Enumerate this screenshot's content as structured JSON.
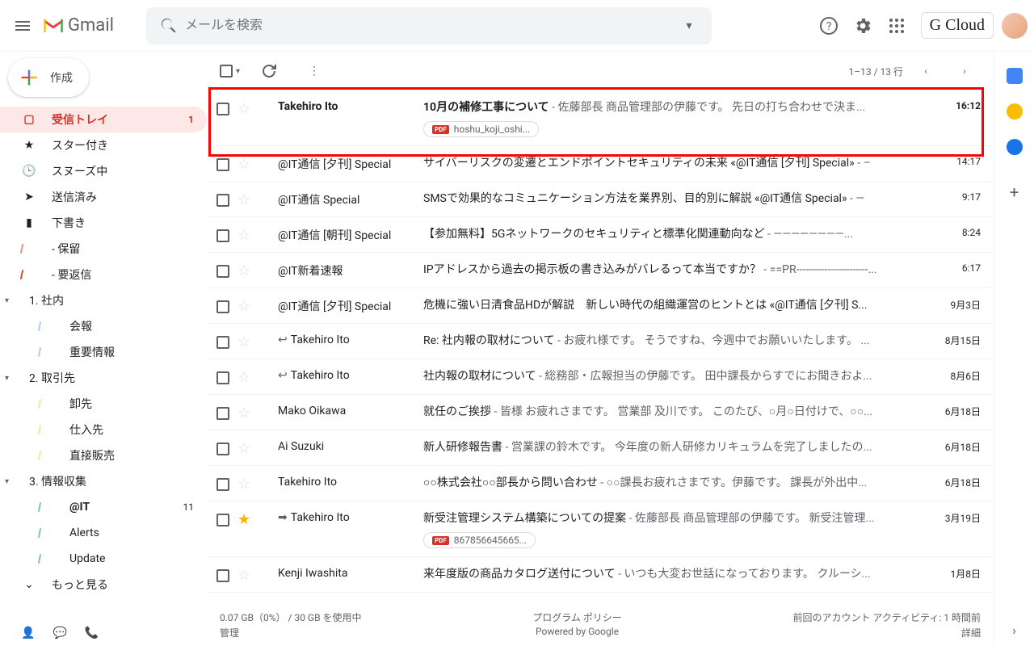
{
  "header": {
    "logo_text": "Gmail",
    "search_placeholder": "メールを検索",
    "gcloud_label": "G Cloud"
  },
  "compose_label": "作成",
  "nav": {
    "inbox": {
      "label": "受信トレイ",
      "count": "1"
    },
    "starred": "スター付き",
    "snoozed": "スヌーズ中",
    "sent": "送信済み",
    "drafts": "下書き",
    "hold": "- 保留",
    "reply_needed": "- 要返信",
    "section1": "1. 社内",
    "s1_news": "会報",
    "s1_important": "重要情報",
    "section2": "2. 取引先",
    "s2_sales": "卸先",
    "s2_supplier": "仕入先",
    "s2_direct": "直接販売",
    "section3": "3. 情報収集",
    "s3_atit": "@IT",
    "s3_atit_count": "11",
    "s3_alerts": "Alerts",
    "s3_update": "Update",
    "more": "もっと見る"
  },
  "toolbar": {
    "page_info": "1–13 / 13 行"
  },
  "emails": [
    {
      "sender": "Takehiro Ito",
      "bold": true,
      "subject": "10月の補修工事について",
      "preview": " - 佐藤部長 商品管理部の伊藤です。 先日の打ち合わせで決ま...",
      "time": "16:12",
      "attachment": "hoshu_koji_oshi..."
    },
    {
      "sender": "@IT通信 [夕刊] Special",
      "subject": "サイバーリスクの変遷とエンドポイントセキュリティの未来 «@IT通信 [夕刊] Special»",
      "preview": " - –",
      "time": "14:17"
    },
    {
      "sender": "@IT通信 Special",
      "subject": "SMSで効果的なコミュニケーション方法を業界別、目的別に解説 «@IT通信 Special»",
      "preview": " - —",
      "time": "9:17"
    },
    {
      "sender": "@IT通信 [朝刊] Special",
      "subject": "【参加無料】5Gネットワークのセキュリティと標準化関連動向など",
      "preview": " - ————————...",
      "time": "8:24"
    },
    {
      "sender": "@IT新着速報",
      "subject": "IPアドレスから過去の掲示板の書き込みがバレるって本当ですか？",
      "preview": " - ==PR-----------------------...",
      "time": "6:17"
    },
    {
      "sender": "@IT通信 [夕刊] Special",
      "subject": "危機に強い日清食品HDが解説　新しい時代の組織運営のヒントとは «@IT通信 [夕刊] S...",
      "preview": "",
      "time": "9月3日"
    },
    {
      "sender": "Takehiro Ito",
      "reply": true,
      "subject": "Re: 社内報の取材について",
      "preview": " - お疲れ様です。 そうですね、今週中でお願いいたします。 ...",
      "time": "8月15日"
    },
    {
      "sender": "Takehiro Ito",
      "reply": true,
      "subject": "社内報の取材について",
      "preview": " - 総務部・広報担当の伊藤です。 田中課長からすでにお聞きおよ...",
      "time": "8月6日"
    },
    {
      "sender": "Mako Oikawa",
      "subject": "就任のご挨拶",
      "preview": " - 皆様 お疲れさまです。 営業部 及川です。 このたび、○月○日付けで、○○...",
      "time": "6月18日"
    },
    {
      "sender": "Ai Suzuki",
      "subject": "新人研修報告書",
      "preview": " - 営業課の鈴木です。 今年度の新人研修カリキュラムを完了しましたの...",
      "time": "6月18日"
    },
    {
      "sender": "Takehiro Ito",
      "subject": "○○株式会社○○部長から問い合わせ",
      "preview": " - ○○課長お疲れさまです。伊藤です。 課長が外出中...",
      "time": "6月18日"
    },
    {
      "sender": "Takehiro Ito",
      "starred": true,
      "forward": true,
      "subject": "新受注管理システム構築についての提案",
      "preview": " - 佐藤部長 商品管理部の伊藤です。 新受注管理...",
      "time": "3月19日",
      "attachment": "867856645665..."
    },
    {
      "sender": "Kenji Iwashita",
      "subject": "来年度版の商品カタログ送付について",
      "preview": " - いつも大変お世話になっております。 クルーシ...",
      "time": "1月8日"
    }
  ],
  "footer": {
    "storage": "0.07 GB（0%） / 30 GB を使用中",
    "manage": "管理",
    "policy": "プログラム ポリシー",
    "powered": "Powered by Google",
    "activity": "前回のアカウント アクティビティ: 1 時間前",
    "detail": "詳細"
  }
}
